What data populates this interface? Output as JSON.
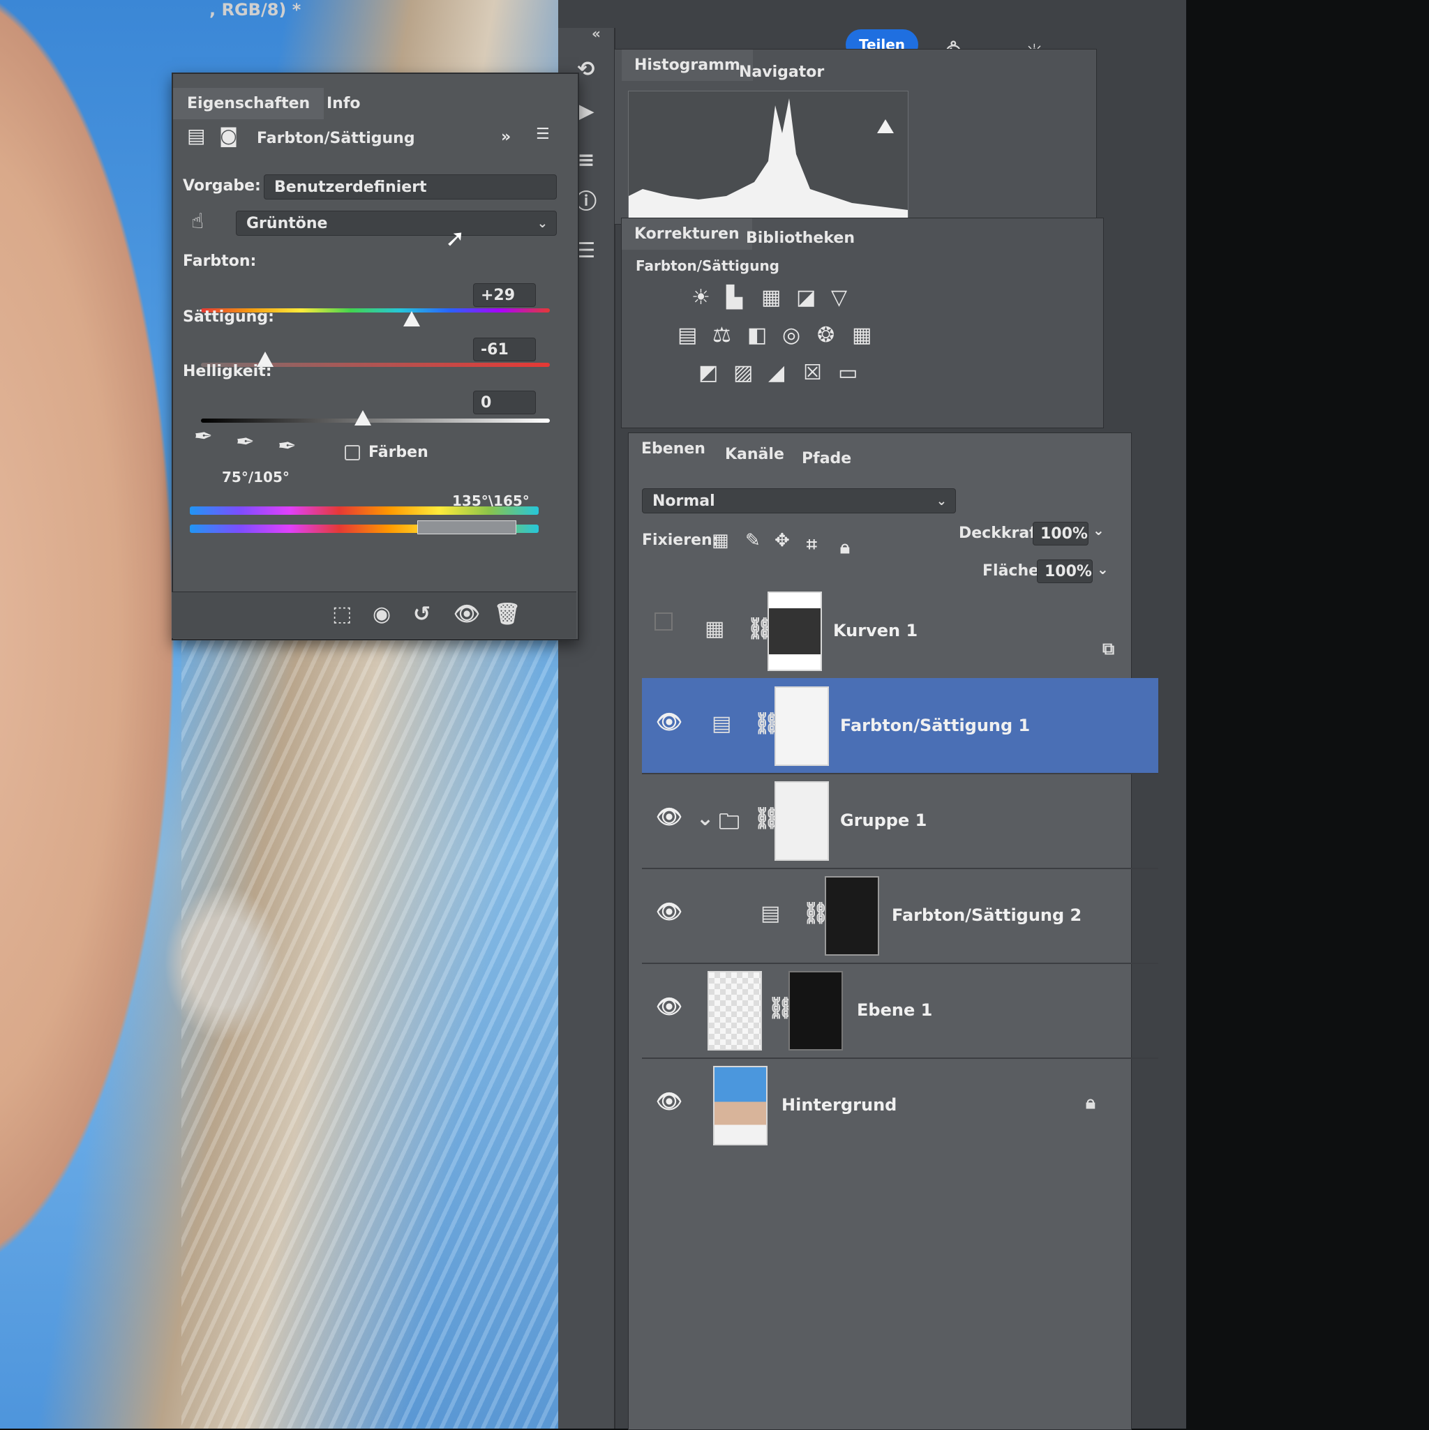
{
  "canvas": {
    "title_fragment": ", RGB/8) *"
  },
  "topbar": {
    "share_label": "Teilen",
    "icons": [
      "bell-icon",
      "search-icon",
      "bulb-icon",
      "panel-icon"
    ]
  },
  "properties": {
    "tabs": [
      "Eigenschaften",
      "Info"
    ],
    "heading": "Farbton/Sättigung",
    "preset_label": "Vorgabe:",
    "preset_value": "Benutzerdefiniert",
    "channel_value": "Grüntöne",
    "hue": {
      "label": "Farbton:",
      "value": "+29"
    },
    "saturation": {
      "label": "Sättigung:",
      "value": "-61"
    },
    "lightness": {
      "label": "Helligkeit:",
      "value": "0"
    },
    "colorize_label": "Färben",
    "range_left": "75°/105°",
    "range_right": "135°\\165°"
  },
  "histogram_panel": {
    "tabs": [
      "Histogramm",
      "Navigator"
    ]
  },
  "corrections_panel": {
    "tabs": [
      "Korrekturen",
      "Bibliotheken"
    ],
    "subtitle": "Farbton/Sättigung"
  },
  "layers_panel": {
    "tabs": [
      "Ebenen",
      "Kanäle",
      "Pfade"
    ],
    "blend_mode": "Normal",
    "lock_label": "Fixieren:",
    "opacity_label": "Deckkraft:",
    "opacity_value": "100%",
    "fill_label": "Fläche:",
    "fill_value": "100%",
    "layers": [
      {
        "name": "Kurven 1"
      },
      {
        "name": "Farbton/Sättigung 1"
      },
      {
        "name": "Gruppe 1"
      },
      {
        "name": "Farbton/Sättigung 2"
      },
      {
        "name": "Ebene 1"
      },
      {
        "name": "Hintergrund"
      }
    ]
  }
}
